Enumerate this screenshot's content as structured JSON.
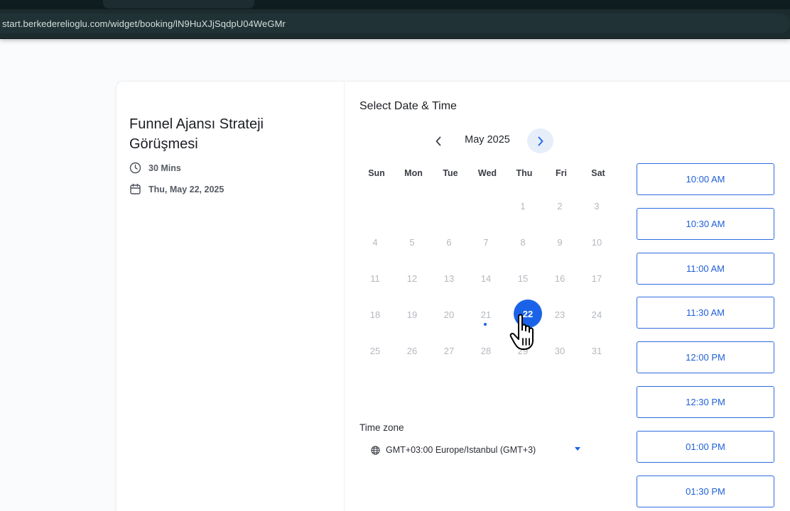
{
  "browser": {
    "url": "start.berkederelioglu.com/widget/booking/lN9HuXJjSqdpU04WeGMr"
  },
  "event": {
    "title": "Funnel Ajansı Strateji Görüşmesi",
    "duration": "30 Mins",
    "date": "Thu, May 22, 2025",
    "duration_icon": "clock-icon",
    "date_icon": "calendar-icon"
  },
  "picker": {
    "section_title": "Select Date & Time",
    "month_label": "May 2025",
    "prev_icon": "chevron-left-icon",
    "next_icon": "chevron-right-icon",
    "weekdays": [
      "Sun",
      "Mon",
      "Tue",
      "Wed",
      "Thu",
      "Fri",
      "Sat"
    ],
    "days": [
      "1",
      "2",
      "3",
      "4",
      "5",
      "6",
      "7",
      "8",
      "9",
      "10",
      "11",
      "12",
      "13",
      "14",
      "15",
      "16",
      "17",
      "18",
      "19",
      "20",
      "21",
      "22",
      "23",
      "24",
      "25",
      "26",
      "27",
      "28",
      "29",
      "30",
      "31"
    ],
    "selected_day": "22",
    "today_marker_day": "21"
  },
  "timezone": {
    "label": "Time zone",
    "value": "GMT+03:00 Europe/Istanbul (GMT+3)",
    "icon": "globe-icon"
  },
  "slots": [
    "10:00 AM",
    "10:30 AM",
    "11:00 AM",
    "11:30 AM",
    "12:00 PM",
    "12:30 PM",
    "01:00 PM",
    "01:30 PM"
  ],
  "colors": {
    "accent": "#1a63e8",
    "slot_border": "#2f6be0",
    "disabled_day": "#b4b8bf"
  }
}
